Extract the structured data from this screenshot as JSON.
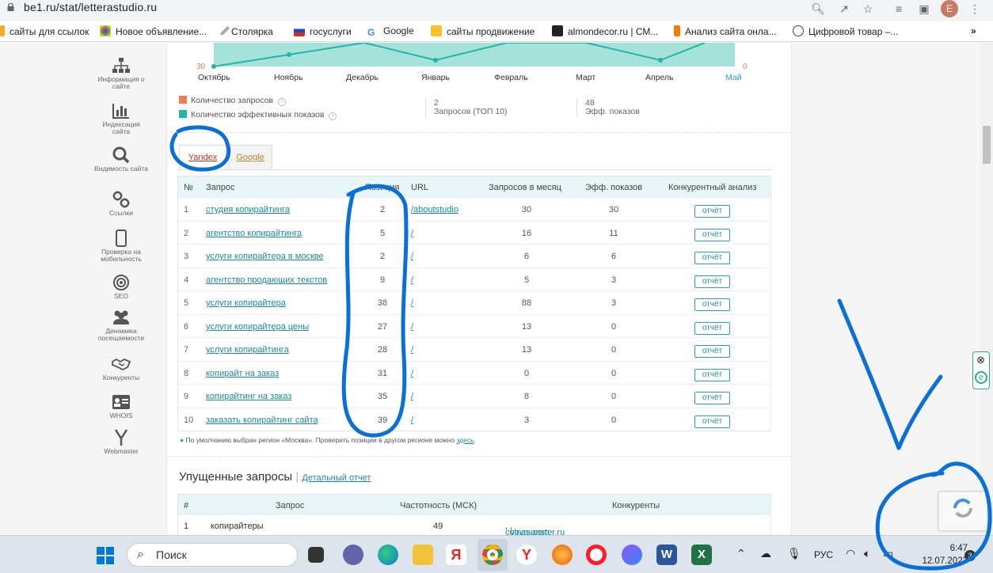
{
  "browser": {
    "url": "be1.ru/stat/letterastudio.ru",
    "profile_initial": "E",
    "bookmarks": [
      "сайты для ссылок",
      "Новое объявление...",
      "Столярка",
      "госуслуги",
      "Google",
      "сайты продвижение",
      "almondecor.ru | СМ...",
      "Анализ сайта онла...",
      "Цифровой товар –..."
    ],
    "more_bookmarks": "»"
  },
  "sidebar": {
    "items": [
      {
        "label": "Информация о сайте",
        "icon": "sitemap-icon"
      },
      {
        "label": "Индексация сайта",
        "icon": "bar-chart-icon"
      },
      {
        "label": "Видимость сайта",
        "icon": "search-icon"
      },
      {
        "label": "Ссылки",
        "icon": "link-icon"
      },
      {
        "label": "Проверка на мобильность",
        "icon": "mobile-icon"
      },
      {
        "label": "SEO",
        "icon": "target-icon"
      },
      {
        "label": "Динамика посещаемости",
        "icon": "users-icon"
      },
      {
        "label": "Конкуренты",
        "icon": "handshake-icon"
      },
      {
        "label": "WHOIS",
        "icon": "id-card-icon"
      },
      {
        "label": "Webmaster",
        "icon": "yandex-icon"
      }
    ]
  },
  "chart": {
    "left_value": "30",
    "right_value": "0",
    "months": [
      "Октябрь",
      "Ноябрь",
      "Декабрь",
      "Январь",
      "Февраль",
      "Март",
      "Апрель",
      "Май"
    ],
    "legend": [
      {
        "label": "Количество запросов",
        "color": "#f47c4f"
      },
      {
        "label": "Количество эффективных показов",
        "color": "#26b3a8"
      }
    ],
    "stats": [
      {
        "value": "2",
        "label": "Запросов (ТОП 10)"
      },
      {
        "value": "48",
        "label": "Эфф. показов"
      }
    ]
  },
  "tabs": [
    "Yandex",
    "Google"
  ],
  "table": {
    "headers": [
      "№",
      "Запрос",
      "Позиция",
      "URL",
      "Запросов в месяц",
      "Эфф. показов",
      "Конкурентный анализ"
    ],
    "button_label": "отчёт",
    "rows": [
      {
        "n": "1",
        "query": "студия копирайтинга",
        "pos": "2",
        "url": "/aboutstudio",
        "month": "30",
        "eff": "30"
      },
      {
        "n": "2",
        "query": "агентство копирайтинга",
        "pos": "5",
        "url": "/",
        "month": "16",
        "eff": "11"
      },
      {
        "n": "3",
        "query": "услуги копирайтера в москве",
        "pos": "2",
        "url": "/",
        "month": "6",
        "eff": "6"
      },
      {
        "n": "4",
        "query": "агентство продающих текстов",
        "pos": "9",
        "url": "/",
        "month": "5",
        "eff": "3"
      },
      {
        "n": "5",
        "query": "услуги копирайтера",
        "pos": "38",
        "url": "/",
        "month": "88",
        "eff": "3"
      },
      {
        "n": "6",
        "query": "услуги копирайтера цены",
        "pos": "27",
        "url": "/",
        "month": "13",
        "eff": "0"
      },
      {
        "n": "7",
        "query": "услуги копирайтинга",
        "pos": "28",
        "url": "/",
        "month": "13",
        "eff": "0"
      },
      {
        "n": "8",
        "query": "копирайт на заказ",
        "pos": "31",
        "url": "/",
        "month": "0",
        "eff": "0"
      },
      {
        "n": "9",
        "query": "копирайтинг на заказ",
        "pos": "35",
        "url": "/",
        "month": "8",
        "eff": "0"
      },
      {
        "n": "10",
        "query": "заказать копирайтинг сайта",
        "pos": "39",
        "url": "/",
        "month": "3",
        "eff": "0"
      }
    ]
  },
  "note": {
    "text": "По умолчанию выбран регион «Москва». Проверить позиции в другом регионе можно",
    "link": "здесь"
  },
  "missed": {
    "title": "Упущенные запросы",
    "separator": "|",
    "detail_link": "Детальный отчет",
    "headers": [
      "#",
      "Запрос",
      "Частотность (МСК)",
      "Конкуренты"
    ],
    "rows": [
      {
        "n": "1",
        "query": "копирайтеры",
        "freq": "49",
        "competitors": [
          "copymonster.ru",
          "ylnas.com"
        ]
      }
    ]
  },
  "taskbar": {
    "search_label": "Поиск",
    "language": "РУС",
    "time": "6:47",
    "date": "12.07.2023",
    "notifications": "3"
  }
}
